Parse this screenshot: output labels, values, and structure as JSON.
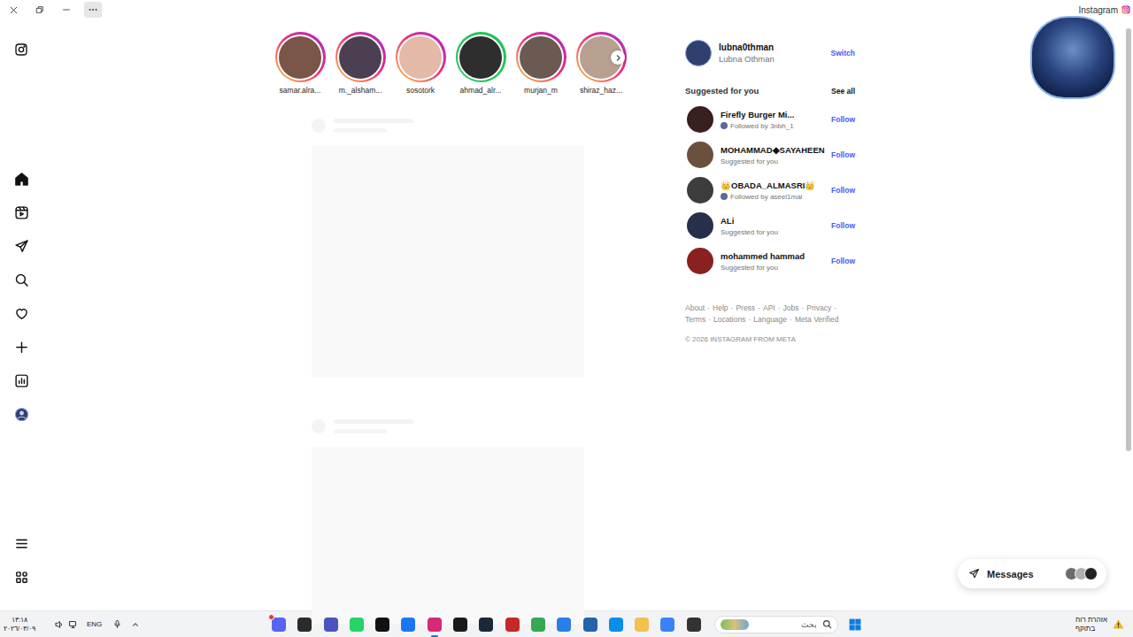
{
  "window": {
    "title": "Instagram",
    "more_highlighted": true
  },
  "sidebar": {
    "items": [
      {
        "selected": true
      },
      {
        "selected": false
      },
      {
        "selected": false
      },
      {
        "selected": false
      },
      {
        "selected": false
      },
      {
        "selected": false
      },
      {
        "selected": false
      },
      {
        "selected": false
      },
      {
        "selected": false
      },
      {
        "selected": false
      }
    ]
  },
  "stories": [
    {
      "username": "samar.alra...",
      "close_friend": false
    },
    {
      "username": "m._alsham...",
      "close_friend": false
    },
    {
      "username": "sosotork",
      "close_friend": false
    },
    {
      "username": "ahmad_alr...",
      "close_friend": true
    },
    {
      "username": "murjan_m",
      "close_friend": false
    },
    {
      "username": "shiraz_haz...",
      "close_friend": false
    }
  ],
  "account": {
    "username": "lubna0thman",
    "full_name": "Lubna Othman",
    "action": "Switch"
  },
  "suggestions": {
    "title": "Suggested for you",
    "see_all": "See all",
    "items": [
      {
        "name": "Firefly Burger Mi...",
        "subtitle": "Followed by 3nbh_1",
        "kind": "mutual",
        "action": "Follow"
      },
      {
        "name": "MOHAMMAD◆SAYAHEEN",
        "subtitle": "Suggested for you",
        "kind": "suggested",
        "action": "Follow"
      },
      {
        "name": "👑OBADA_ALMASRI👑",
        "subtitle": "Followed by aseel1mai",
        "kind": "mutual",
        "action": "Follow"
      },
      {
        "name": "ALi",
        "subtitle": "Suggested for you",
        "kind": "suggested",
        "action": "Follow"
      },
      {
        "name": "mohammed hammad",
        "subtitle": "Suggested for you",
        "kind": "suggested",
        "action": "Follow"
      }
    ]
  },
  "footer": {
    "links": [
      "About",
      "Help",
      "Press",
      "API",
      "Jobs",
      "Privacy",
      "Terms",
      "Locations",
      "Language",
      "Meta Verified"
    ],
    "separator": "·",
    "copyright": "© 2026 INSTAGRAM FROM META"
  },
  "messages": {
    "label": "Messages"
  },
  "taskbar": {
    "time": "١٣:١٨",
    "date": "٢٠٢٦/٠٣/٠٩",
    "language": "ENG",
    "search_placeholder": "بحث",
    "weather_line1": "אזהרת רוח",
    "weather_line2": "בתוקף",
    "apps": [
      {
        "selected": false,
        "badge": true,
        "color": "#5865f2"
      },
      {
        "selected": false,
        "badge": false,
        "color": "#2b2b2b"
      },
      {
        "selected": false,
        "badge": false,
        "color": "#4b53bc"
      },
      {
        "selected": false,
        "badge": false,
        "color": "#25d366"
      },
      {
        "selected": false,
        "badge": false,
        "color": "#111111"
      },
      {
        "selected": false,
        "badge": false,
        "color": "#1877f2"
      },
      {
        "selected": true,
        "badge": false,
        "color": "#d62976"
      },
      {
        "selected": false,
        "badge": false,
        "color": "#1a1a1a"
      },
      {
        "selected": false,
        "badge": false,
        "color": "#1b2838"
      },
      {
        "selected": false,
        "badge": false,
        "color": "#c62828"
      },
      {
        "selected": false,
        "badge": false,
        "color": "#34a853"
      },
      {
        "selected": false,
        "badge": false,
        "color": "#2a7ee8"
      },
      {
        "selected": false,
        "badge": false,
        "color": "#2563a8"
      },
      {
        "selected": false,
        "badge": false,
        "color": "#0c8ce9"
      },
      {
        "selected": false,
        "badge": false,
        "color": "#f2c14e"
      },
      {
        "selected": false,
        "badge": false,
        "color": "#3b82f6"
      },
      {
        "selected": false,
        "badge": false,
        "color": "#333333"
      }
    ]
  }
}
